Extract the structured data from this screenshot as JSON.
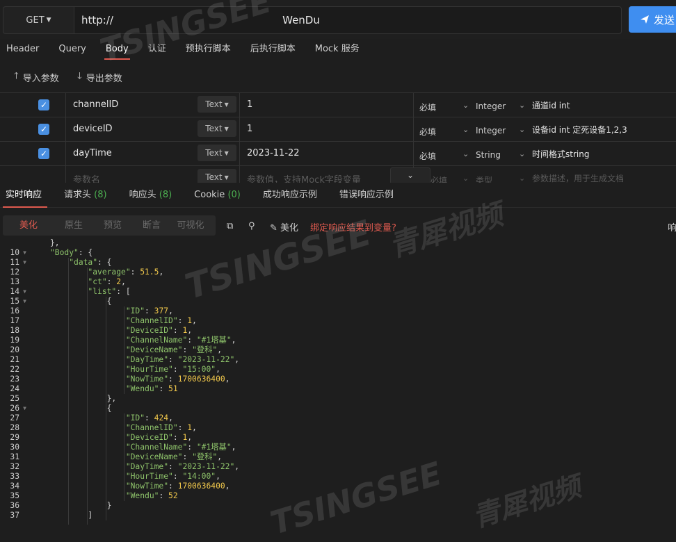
{
  "request": {
    "method": "GET",
    "url": "http://                                                   WenDu",
    "send_label": "发送"
  },
  "req_tabs": [
    "Header",
    "Query",
    "Body",
    "认证",
    "预执行脚本",
    "后执行脚本",
    "Mock 服务"
  ],
  "params_toolbar": {
    "import": "导入参数",
    "export": "导出参数"
  },
  "params": [
    {
      "checked": true,
      "key": "channelID",
      "type": "Text",
      "value": "1",
      "required": "必填",
      "dtype": "Integer",
      "desc": "通道id int"
    },
    {
      "checked": true,
      "key": "deviceID",
      "type": "Text",
      "value": "1",
      "required": "必填",
      "dtype": "Integer",
      "desc": "设备id int  定死设备1,2,3"
    },
    {
      "checked": true,
      "key": "dayTime",
      "type": "Text",
      "value": "2023-11-22",
      "required": "必填",
      "dtype": "String",
      "desc": "时间格式string"
    }
  ],
  "new_param": {
    "key_placeholder": "参数名",
    "type": "Text",
    "value_placeholder": "参数值，支持Mock字段变量",
    "required": "必填",
    "dtype": "类型",
    "desc_placeholder": "参数描述，用于生成文档"
  },
  "resp_tabs": [
    {
      "label": "实时响应",
      "count": ""
    },
    {
      "label": "请求头",
      "count": "(8)"
    },
    {
      "label": "响应头",
      "count": "(8)"
    },
    {
      "label": "Cookie",
      "count": "(0)"
    },
    {
      "label": "成功响应示例",
      "count": ""
    },
    {
      "label": "错误响应示例",
      "count": ""
    }
  ],
  "view_modes": [
    "美化",
    "原生",
    "预览",
    "断言",
    "可视化"
  ],
  "beautify_label": "美化",
  "bind_label": "绑定响应结果到变量?",
  "resp_right": "响",
  "watermark": {
    "brand": "TSINGSEE",
    "cn": "青犀视频"
  },
  "code_lines": [
    {
      "n": "",
      "t": "    },"
    },
    {
      "n": "10",
      "f": true,
      "t": "    \"Body\": {"
    },
    {
      "n": "11",
      "f": true,
      "t": "        \"data\": {"
    },
    {
      "n": "12",
      "t": "            \"average\": 51.5,"
    },
    {
      "n": "13",
      "t": "            \"ct\": 2,"
    },
    {
      "n": "14",
      "f": true,
      "t": "            \"list\": ["
    },
    {
      "n": "15",
      "f": true,
      "t": "                {"
    },
    {
      "n": "16",
      "t": "                    \"ID\": 377,"
    },
    {
      "n": "17",
      "t": "                    \"ChannelID\": 1,"
    },
    {
      "n": "18",
      "t": "                    \"DeviceID\": 1,"
    },
    {
      "n": "19",
      "t": "                    \"ChannelName\": \"#1塔基\","
    },
    {
      "n": "20",
      "t": "                    \"DeviceName\": \"登科\","
    },
    {
      "n": "21",
      "t": "                    \"DayTime\": \"2023-11-22\","
    },
    {
      "n": "22",
      "t": "                    \"HourTime\": \"15:00\","
    },
    {
      "n": "23",
      "t": "                    \"NowTime\": 1700636400,"
    },
    {
      "n": "24",
      "t": "                    \"Wendu\": 51"
    },
    {
      "n": "25",
      "t": "                },"
    },
    {
      "n": "26",
      "f": true,
      "t": "                {"
    },
    {
      "n": "27",
      "t": "                    \"ID\": 424,"
    },
    {
      "n": "28",
      "t": "                    \"ChannelID\": 1,"
    },
    {
      "n": "29",
      "t": "                    \"DeviceID\": 1,"
    },
    {
      "n": "30",
      "t": "                    \"ChannelName\": \"#1塔基\","
    },
    {
      "n": "31",
      "t": "                    \"DeviceName\": \"登科\","
    },
    {
      "n": "32",
      "t": "                    \"DayTime\": \"2023-11-22\","
    },
    {
      "n": "33",
      "t": "                    \"HourTime\": \"14:00\","
    },
    {
      "n": "34",
      "t": "                    \"NowTime\": 1700636400,"
    },
    {
      "n": "35",
      "t": "                    \"Wendu\": 52"
    },
    {
      "n": "36",
      "t": "                }"
    },
    {
      "n": "37",
      "t": "            ]"
    }
  ]
}
